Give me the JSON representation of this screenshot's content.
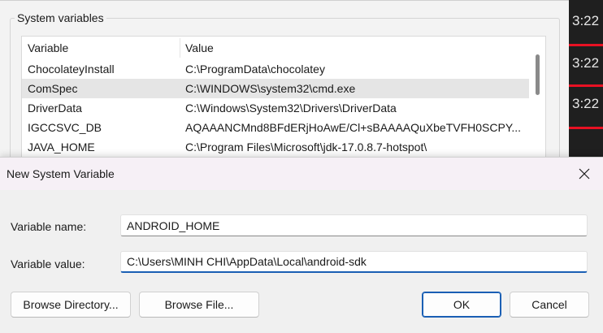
{
  "background": {
    "group_title": "System variables",
    "columns": [
      "Variable",
      "Value"
    ],
    "rows": [
      {
        "name": "ChocolateyInstall",
        "value": "C:\\ProgramData\\chocolatey",
        "selected": false
      },
      {
        "name": "ComSpec",
        "value": "C:\\WINDOWS\\system32\\cmd.exe",
        "selected": true
      },
      {
        "name": "DriverData",
        "value": "C:\\Windows\\System32\\Drivers\\DriverData",
        "selected": false
      },
      {
        "name": "IGCCSVC_DB",
        "value": "AQAAANCMnd8BFdERjHoAwE/Cl+sBAAAAQuXbeTVFH0SCPY...",
        "selected": false
      },
      {
        "name": "JAVA_HOME",
        "value": "C:\\Program Files\\Microsoft\\jdk-17.0.8.7-hotspot\\",
        "selected": false
      }
    ]
  },
  "side_clock": [
    "3:22",
    "3:22",
    "3:22"
  ],
  "dialog": {
    "title": "New System Variable",
    "name_label": "Variable name:",
    "name_value": "ANDROID_HOME",
    "value_label": "Variable value:",
    "value_value": "C:\\Users\\MINH CHI\\AppData\\Local\\android-sdk",
    "browse_directory_label": "Browse Directory...",
    "browse_file_label": "Browse File...",
    "ok_label": "OK",
    "cancel_label": "Cancel"
  },
  "icons": {
    "close": "close-icon"
  },
  "colors": {
    "accent": "#1a5fb4",
    "selection": "#e5e5e5",
    "taskbar": "#1f1f1f",
    "indicator": "#e81123"
  }
}
